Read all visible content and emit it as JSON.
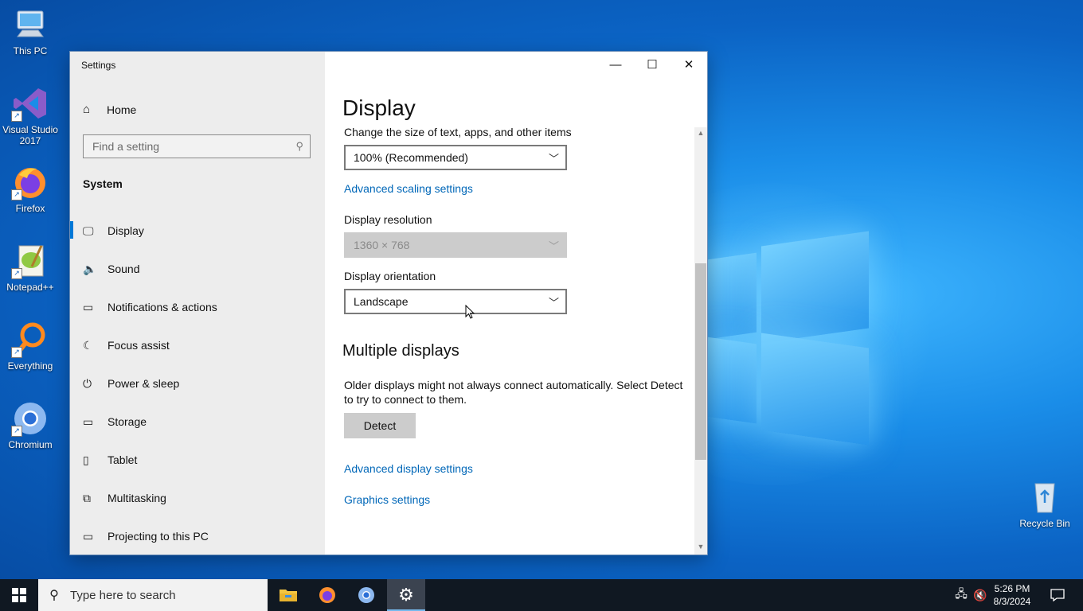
{
  "desktop": {
    "icons": [
      {
        "label": "This PC",
        "icon": "computer-icon"
      },
      {
        "label": "Visual Studio 2017",
        "icon": "visual-studio-icon"
      },
      {
        "label": "Firefox",
        "icon": "firefox-icon"
      },
      {
        "label": "Notepad++",
        "icon": "notepadpp-icon"
      },
      {
        "label": "Everything",
        "icon": "everything-search-icon"
      },
      {
        "label": "Chromium",
        "icon": "chromium-icon"
      },
      {
        "label": "Recycle Bin",
        "icon": "recycle-bin-icon"
      }
    ]
  },
  "window": {
    "title": "Settings",
    "controls": {
      "minimize": "—",
      "maximize": "☐",
      "close": "✕"
    }
  },
  "sidebar": {
    "home_label": "Home",
    "search_placeholder": "Find a setting",
    "section": "System",
    "items": [
      {
        "label": "Display",
        "icon": "monitor-icon",
        "selected": true
      },
      {
        "label": "Sound",
        "icon": "speaker-icon"
      },
      {
        "label": "Notifications & actions",
        "icon": "notification-icon"
      },
      {
        "label": "Focus assist",
        "icon": "moon-icon"
      },
      {
        "label": "Power & sleep",
        "icon": "power-icon"
      },
      {
        "label": "Storage",
        "icon": "storage-icon"
      },
      {
        "label": "Tablet",
        "icon": "tablet-icon"
      },
      {
        "label": "Multitasking",
        "icon": "multitasking-icon"
      },
      {
        "label": "Projecting to this PC",
        "icon": "projecting-icon"
      }
    ]
  },
  "content": {
    "title": "Display",
    "scale_label": "Change the size of text, apps, and other items",
    "scale_value": "100% (Recommended)",
    "advanced_scaling_link": "Advanced scaling settings",
    "resolution_label": "Display resolution",
    "resolution_value": "1360 × 768",
    "orientation_label": "Display orientation",
    "orientation_value": "Landscape",
    "multiple_displays_title": "Multiple displays",
    "multiple_displays_text": "Older displays might not always connect automatically. Select Detect to try to connect to them.",
    "detect_button": "Detect",
    "advanced_display_link": "Advanced display settings",
    "graphics_link": "Graphics settings"
  },
  "taskbar": {
    "search_placeholder": "Type here to search",
    "pinned": [
      "file-explorer-icon",
      "firefox-icon",
      "chromium-icon",
      "settings-icon"
    ],
    "active": "settings-icon",
    "time": "5:26 PM",
    "date": "8/3/2024"
  }
}
